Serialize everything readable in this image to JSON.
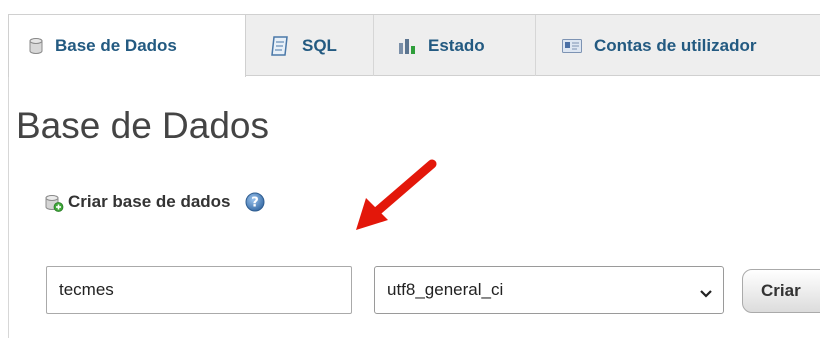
{
  "tabs": [
    {
      "label": "Base de Dados",
      "icon": "database-icon",
      "active": true
    },
    {
      "label": "SQL",
      "icon": "sql-document-icon",
      "active": false
    },
    {
      "label": "Estado",
      "icon": "status-chart-icon",
      "active": false
    },
    {
      "label": "Contas de utilizador",
      "icon": "user-accounts-icon",
      "active": false
    }
  ],
  "main": {
    "title": "Base de Dados",
    "create_section": {
      "heading": "Criar base de dados",
      "db_name_value": "tecmes",
      "collation_selected": "utf8_general_ci",
      "create_label": "Criar"
    }
  },
  "colors": {
    "tab_text": "#235a81",
    "arrow": "#e3170a",
    "tab_bar": "#eeeeee"
  }
}
